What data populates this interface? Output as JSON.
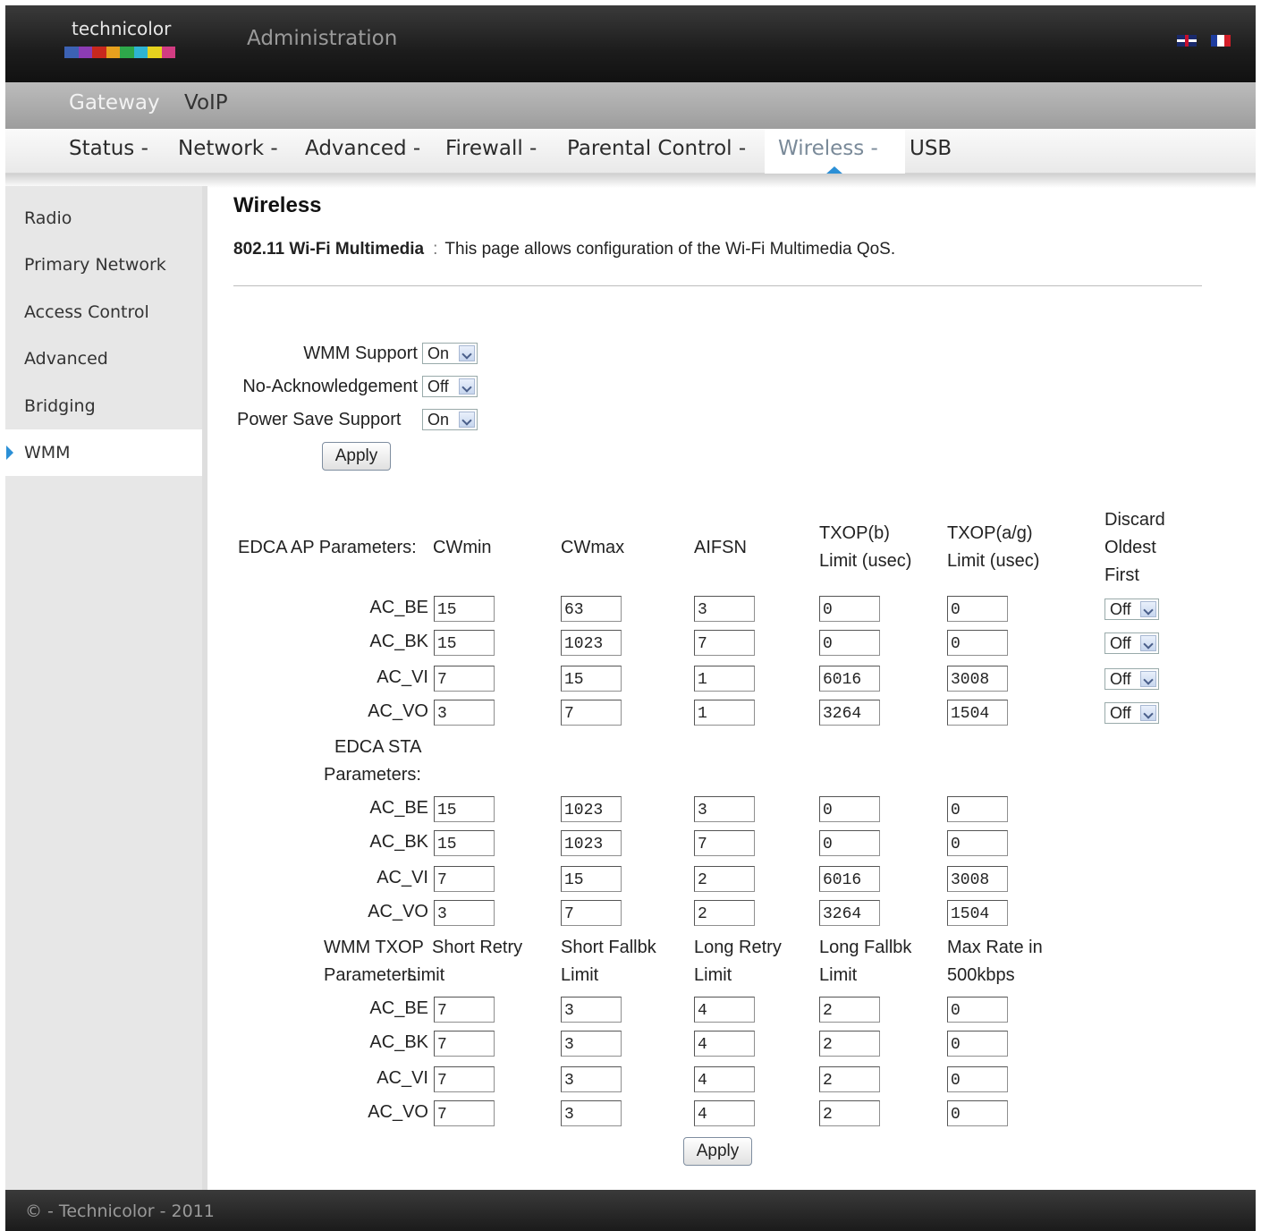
{
  "header": {
    "logo_text": "technicolor",
    "title": "Administration",
    "logo_colors": [
      "#3c62b4",
      "#8c3cb4",
      "#c8281e",
      "#e6a01e",
      "#2ea84a",
      "#2eb4d2",
      "#e6d21e",
      "#d23c82"
    ],
    "flag_fr_colors": [
      "#1e3c9e",
      "#ffffff",
      "#d21e28"
    ]
  },
  "top_nav": {
    "items": [
      "Gateway",
      "VoIP"
    ],
    "active": "Gateway"
  },
  "sub_nav": {
    "items": [
      "Status -",
      "Network -",
      "Advanced -",
      "Firewall -",
      "Parental Control -",
      "Wireless -",
      "USB"
    ],
    "active": "Wireless -",
    "accent_color": "#2b8fd6"
  },
  "sidebar": {
    "items": [
      "Radio",
      "Primary Network",
      "Access Control",
      "Advanced",
      "Bridging",
      "WMM"
    ],
    "active": "WMM"
  },
  "page": {
    "title": "Wireless",
    "description_label": "802.11 Wi-Fi Multimedia",
    "description_sep": ":",
    "description_text": "This page allows configuration of the Wi-Fi Multimedia QoS."
  },
  "wmm_settings": {
    "wmm_support": {
      "label": "WMM Support",
      "value": "On"
    },
    "no_ack": {
      "label": "No-Acknowledgement",
      "value": "Off"
    },
    "power_save": {
      "label": "Power Save Support",
      "value": "On"
    },
    "apply_label": "Apply"
  },
  "edca_ap": {
    "section_label": "EDCA AP Parameters:",
    "columns": [
      "CWmin",
      "CWmax",
      "AIFSN",
      "TXOP(b) Limit (usec)",
      "TXOP(a/g) Limit (usec)",
      "Discard Oldest First"
    ],
    "rows": [
      {
        "ac": "AC_BE",
        "values": [
          "15",
          "63",
          "3",
          "0",
          "0"
        ],
        "discard": "Off"
      },
      {
        "ac": "AC_BK",
        "values": [
          "15",
          "1023",
          "7",
          "0",
          "0"
        ],
        "discard": "Off"
      },
      {
        "ac": "AC_VI",
        "values": [
          "7",
          "15",
          "1",
          "6016",
          "3008"
        ],
        "discard": "Off"
      },
      {
        "ac": "AC_VO",
        "values": [
          "3",
          "7",
          "1",
          "3264",
          "1504"
        ],
        "discard": "Off"
      }
    ]
  },
  "edca_sta": {
    "section_label": "EDCA STA Parameters:",
    "rows": [
      {
        "ac": "AC_BE",
        "values": [
          "15",
          "1023",
          "3",
          "0",
          "0"
        ]
      },
      {
        "ac": "AC_BK",
        "values": [
          "15",
          "1023",
          "7",
          "0",
          "0"
        ]
      },
      {
        "ac": "AC_VI",
        "values": [
          "7",
          "15",
          "2",
          "6016",
          "3008"
        ]
      },
      {
        "ac": "AC_VO",
        "values": [
          "3",
          "7",
          "2",
          "3264",
          "1504"
        ]
      }
    ]
  },
  "txop": {
    "section_label": "WMM TXOP Parameters:",
    "columns": [
      "Short Retry Limit",
      "Short Fallbk Limit",
      "Long Retry Limit",
      "Long Fallbk Limit",
      "Max Rate in 500kbps"
    ],
    "rows": [
      {
        "ac": "AC_BE",
        "values": [
          "7",
          "3",
          "4",
          "2",
          "0"
        ]
      },
      {
        "ac": "AC_BK",
        "values": [
          "7",
          "3",
          "4",
          "2",
          "0"
        ]
      },
      {
        "ac": "AC_VI",
        "values": [
          "7",
          "3",
          "4",
          "2",
          "0"
        ]
      },
      {
        "ac": "AC_VO",
        "values": [
          "7",
          "3",
          "4",
          "2",
          "0"
        ]
      }
    ],
    "apply_label": "Apply"
  },
  "footer": {
    "text": "© - Technicolor - 2011"
  }
}
